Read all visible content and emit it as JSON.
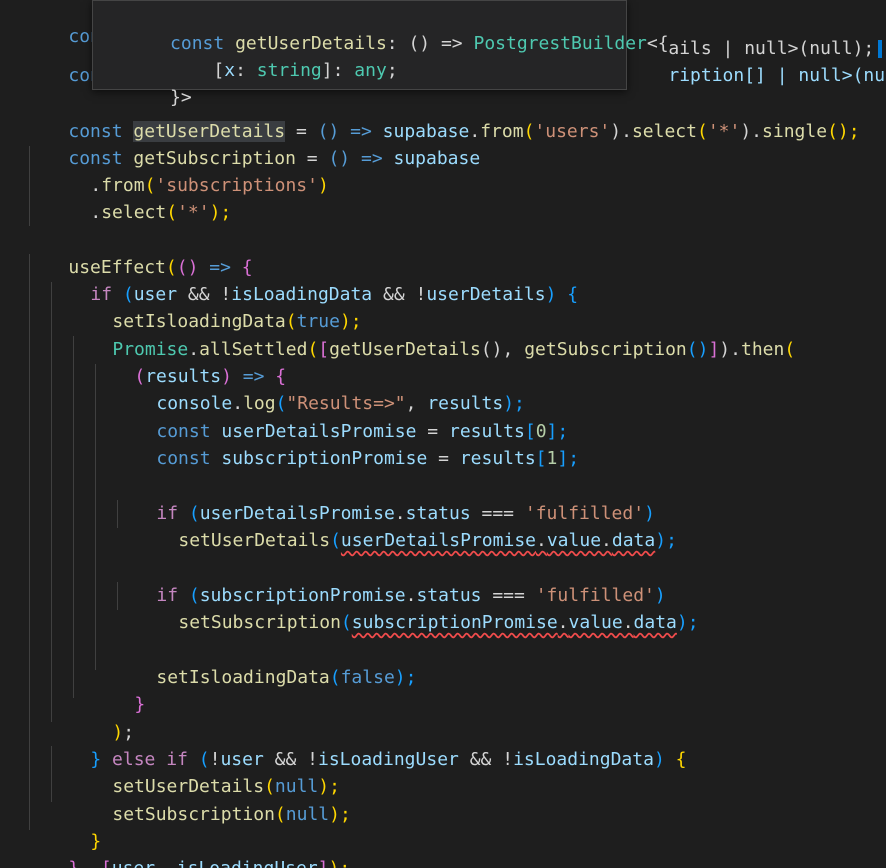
{
  "tooltip": {
    "line1": [
      "const ",
      "getUserDetails",
      ": () => ",
      "PostgrestBuilder",
      "<{"
    ],
    "line2": [
      "    [",
      "x",
      ": ",
      "string",
      "]: ",
      "any",
      ";"
    ],
    "line3": [
      "}>"
    ]
  },
  "code": {
    "line0_kw": "const",
    "line0_tail": "ails | null>(null);",
    "line1_kw": "const",
    "line1_tail": "ription[] | null>(null)",
    "line2": [
      "const ",
      "getUserDetails",
      " = ",
      "() => ",
      "supabase",
      ".",
      "from",
      "(",
      "'users'",
      ").",
      "select",
      "(",
      "'*'",
      ").",
      "single",
      "();"
    ],
    "line3": [
      "const ",
      "getSubscription",
      " = ",
      "() => ",
      "supabase"
    ],
    "line4": [
      ".",
      "from",
      "(",
      "'subscriptions'",
      ")"
    ],
    "line5": [
      ".",
      "select",
      "(",
      "'*'",
      ");"
    ],
    "line7": [
      "useEffect",
      "(",
      "()",
      " => ",
      "{"
    ],
    "line8": [
      "if ",
      "(",
      "user",
      " && !",
      "isLoadingData",
      " && !",
      "userDetails",
      ") ",
      "{"
    ],
    "line9": [
      "setIsloadingData",
      "(",
      "true",
      ");"
    ],
    "line10": [
      "Promise",
      ".",
      "allSettled",
      "(",
      "[",
      "getUserDetails",
      "(), ",
      "getSubscription",
      "()",
      "]",
      ").",
      "then",
      "("
    ],
    "line11": [
      "(",
      "results",
      ")",
      " => ",
      "{"
    ],
    "line12": [
      "console",
      ".",
      "log",
      "(",
      "\"Results=>\"",
      ", ",
      "results",
      ");"
    ],
    "line13": [
      "const ",
      "userDetailsPromise",
      " = ",
      "results",
      "[",
      "0",
      "];"
    ],
    "line14": [
      "const ",
      "subscriptionPromise",
      " = ",
      "results",
      "[",
      "1",
      "];"
    ],
    "line16": [
      "if ",
      "(",
      "userDetailsPromise",
      ".",
      "status",
      " === ",
      "'fulfilled'",
      ")"
    ],
    "line17": [
      "setUserDetails",
      "(",
      "userDetailsPromise",
      ".",
      "value",
      ".",
      "data",
      ");"
    ],
    "line19": [
      "if ",
      "(",
      "subscriptionPromise",
      ".",
      "status",
      " === ",
      "'fulfilled'",
      ")"
    ],
    "line20": [
      "setSubscription",
      "(",
      "subscriptionPromise",
      ".",
      "value",
      ".",
      "data",
      ");"
    ],
    "line22": [
      "setIsloadingData",
      "(",
      "false",
      ");"
    ],
    "line23": [
      "}"
    ],
    "line24": [
      ")",
      ";"
    ],
    "line25": [
      "} ",
      "else if ",
      "(",
      "!",
      "user",
      " && !",
      "isLoadingUser",
      " && !",
      "isLoadingData",
      ") ",
      "{"
    ],
    "line26": [
      "setUserDetails",
      "(",
      "null",
      ");"
    ],
    "line27": [
      "setSubscription",
      "(",
      "null",
      ");"
    ],
    "line28": [
      "}"
    ],
    "line29": [
      "}",
      ", ",
      "[",
      "user",
      ", ",
      "isLoadingUser",
      "]",
      ");"
    ]
  }
}
